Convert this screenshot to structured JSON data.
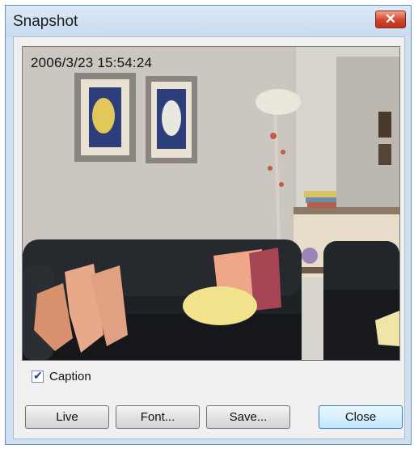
{
  "window": {
    "title": "Snapshot"
  },
  "image": {
    "caption": "2006/3/23 15:54:24"
  },
  "caption_checkbox": {
    "label": "Caption",
    "checked": true
  },
  "buttons": {
    "live": "Live",
    "font": "Font...",
    "save": "Save...",
    "close": "Close"
  },
  "colors": {
    "titlebar": "#cfe0f2",
    "close_button": "#c8442b",
    "dialog_bg": "#f0f0f0"
  },
  "icons": {
    "close": "close-x-icon",
    "check": "checkmark-icon"
  }
}
